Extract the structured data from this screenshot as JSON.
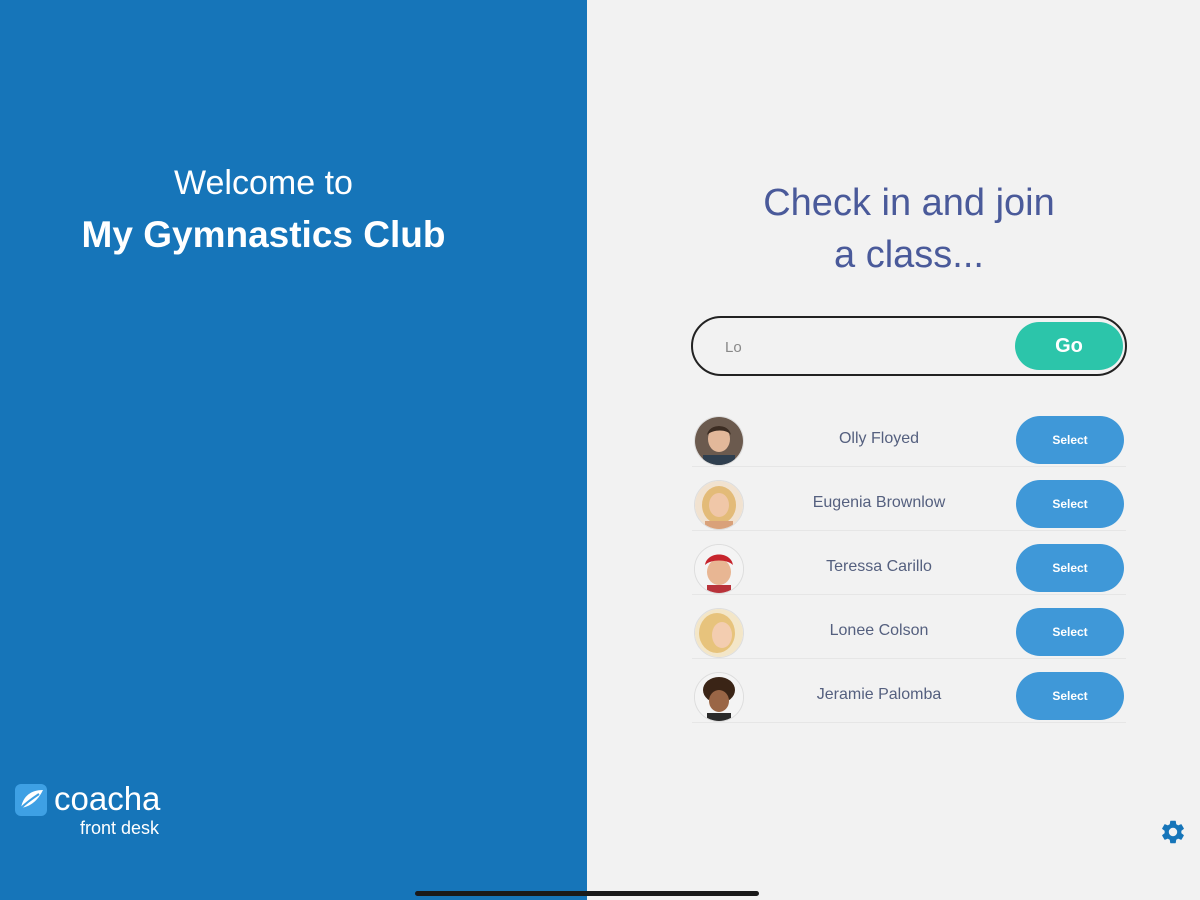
{
  "welcome": {
    "line1": "Welcome to",
    "club_name": "My Gymnastics Club"
  },
  "brand": {
    "name": "coacha",
    "subtitle": "front desk"
  },
  "checkin": {
    "heading_line1": "Check in and join",
    "heading_line2": "a class..."
  },
  "search": {
    "value": "Lo",
    "placeholder": "",
    "go_label": "Go"
  },
  "members": [
    {
      "name": "Olly Floyed",
      "select_label": "Select",
      "avatar_icon": "person-avatar"
    },
    {
      "name": "Eugenia Brownlow",
      "select_label": "Select",
      "avatar_icon": "person-avatar"
    },
    {
      "name": "Teressa Carillo",
      "select_label": "Select",
      "avatar_icon": "person-avatar"
    },
    {
      "name": "Lonee Colson",
      "select_label": "Select",
      "avatar_icon": "person-avatar"
    },
    {
      "name": "Jeramie Palomba",
      "select_label": "Select",
      "avatar_icon": "person-avatar"
    }
  ],
  "colors": {
    "left_panel": "#1675b9",
    "right_panel": "#f2f2f2",
    "go_button": "#2cc5aa",
    "select_button": "#3f98d8",
    "heading_text": "#4a5a9a"
  },
  "icons": {
    "settings": "gear-icon",
    "logo": "coacha-logo-icon"
  }
}
